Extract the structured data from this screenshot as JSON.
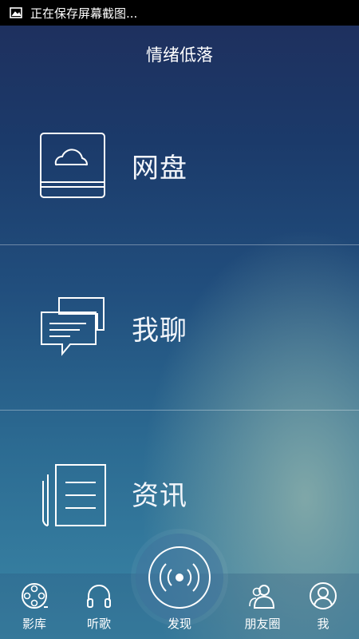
{
  "status_bar": {
    "text": "正在保存屏幕截图...",
    "icon": "image-icon"
  },
  "header": {
    "title": "情绪低落"
  },
  "menu": [
    {
      "label": "网盘",
      "icon": "cloud-drive-icon"
    },
    {
      "label": "我聊",
      "icon": "chat-bubbles-icon"
    },
    {
      "label": "资讯",
      "icon": "news-document-icon"
    }
  ],
  "tabbar": {
    "items": [
      {
        "label": "影库",
        "icon": "film-reel-icon"
      },
      {
        "label": "听歌",
        "icon": "headphones-icon"
      },
      {
        "label": "发现",
        "icon": "radar-broadcast-icon"
      },
      {
        "label": "朋友圈",
        "icon": "friends-icon"
      },
      {
        "label": "我",
        "icon": "profile-icon"
      }
    ]
  }
}
